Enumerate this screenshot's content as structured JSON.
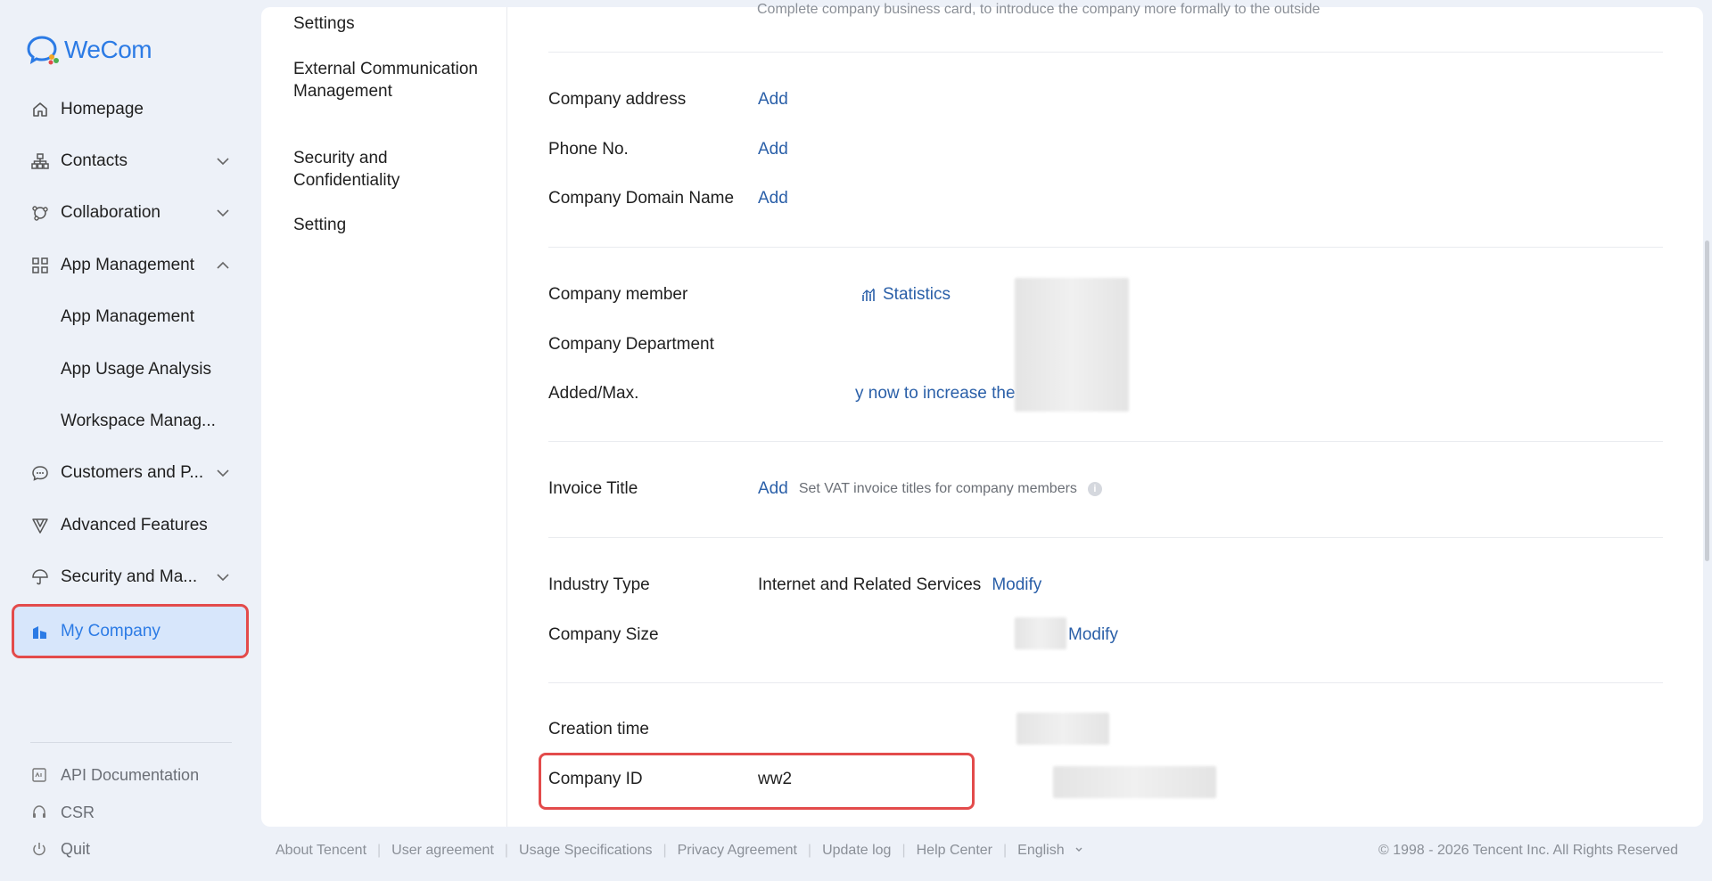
{
  "app": {
    "name": "WeCom",
    "brand_color": "#2c7be5",
    "alert_color": "#e34b4b"
  },
  "sidebar": {
    "items": [
      {
        "label": "Homepage",
        "icon": "home-icon"
      },
      {
        "label": "Contacts",
        "icon": "org-chart-icon"
      },
      {
        "label": "Collaboration",
        "icon": "collaboration-icon"
      },
      {
        "label": "App Management",
        "icon": "apps-grid-icon"
      },
      {
        "label": "App Management"
      },
      {
        "label": "App Usage Analysis"
      },
      {
        "label": "Workspace Manag..."
      },
      {
        "label": "Customers and P...",
        "icon": "chat-bubble-icon"
      },
      {
        "label": "Advanced Features",
        "icon": "advanced-icon"
      },
      {
        "label": "Security and Ma...",
        "icon": "umbrella-icon"
      },
      {
        "label": "My Company",
        "icon": "company-icon"
      }
    ],
    "bottom": [
      {
        "label": "API Documentation",
        "icon": "api-doc-icon"
      },
      {
        "label": "CSR",
        "icon": "headset-icon"
      },
      {
        "label": "Quit",
        "icon": "power-icon"
      }
    ]
  },
  "subnav": {
    "items": [
      "Settings",
      "External Communication Management",
      "Security and Confidentiality",
      "Setting"
    ]
  },
  "content": {
    "cut_text": "Complete company business card, to introduce the company more formally to the outside",
    "address": {
      "label": "Company address",
      "action": "Add"
    },
    "phone": {
      "label": "Phone No.",
      "action": "Add"
    },
    "domain": {
      "label": "Company Domain Name",
      "action": "Add"
    },
    "member": {
      "label": "Company member",
      "action": "Statistics"
    },
    "department": {
      "label": "Company Department"
    },
    "added": {
      "label": "Added/Max.",
      "action": "y now to increase the limit"
    },
    "invoice": {
      "label": "Invoice Title",
      "action": "Add",
      "hint": "Set VAT invoice titles for company members"
    },
    "industry": {
      "label": "Industry Type",
      "value": "Internet and Related Services",
      "action": "Modify"
    },
    "size": {
      "label": "Company Size",
      "action": "Modify"
    },
    "creation": {
      "label": "Creation time"
    },
    "company_id": {
      "label": "Company ID",
      "value": "ww2"
    }
  },
  "footer": {
    "links": [
      "About Tencent",
      "User agreement",
      "Usage Specifications",
      "Privacy Agreement",
      "Update log",
      "Help Center",
      "English"
    ],
    "copyright": "© 1998 - 2026 Tencent Inc. All Rights Reserved"
  }
}
